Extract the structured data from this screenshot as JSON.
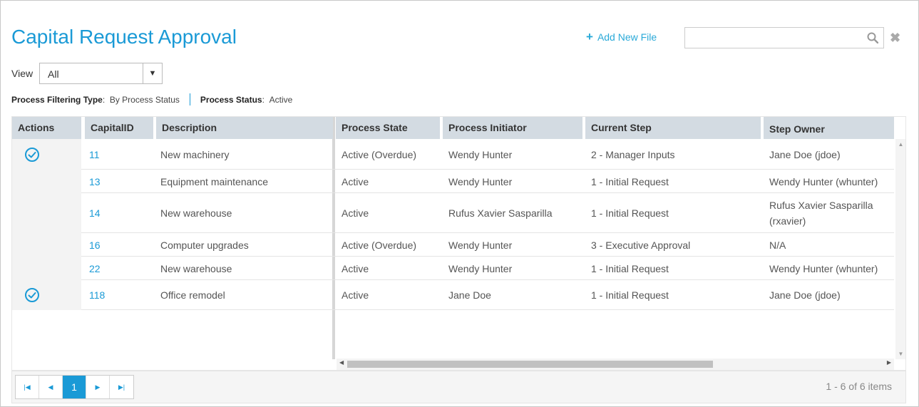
{
  "page": {
    "title": "Capital Request Approval",
    "add_file_label": "Add New File",
    "search_placeholder": "",
    "view_label": "View",
    "view_value": "All",
    "filter_type_label": "Process Filtering Type",
    "filter_type_value": "By Process Status",
    "process_status_label": "Process Status",
    "process_status_value": "Active"
  },
  "grid": {
    "columns": [
      "Actions",
      "CapitalID",
      "Description",
      "Process State",
      "Process Initiator",
      "Current Step",
      "Step Owner"
    ],
    "rows": [
      {
        "action": true,
        "id": "11",
        "description": "New machinery",
        "state": "Active (Overdue)",
        "initiator": "Wendy Hunter",
        "step": "2 - Manager Inputs",
        "owner": "Jane Doe (jdoe)"
      },
      {
        "action": false,
        "id": "13",
        "description": "Equipment maintenance",
        "state": "Active",
        "initiator": "Wendy Hunter",
        "step": "1 - Initial Request",
        "owner": "Wendy Hunter (whunter)"
      },
      {
        "action": false,
        "id": "14",
        "description": "New warehouse",
        "state": "Active",
        "initiator": "Rufus Xavier Sasparilla",
        "step": "1 - Initial Request",
        "owner": "Rufus Xavier Sasparilla",
        "owner2": "(rxavier)"
      },
      {
        "action": false,
        "id": "16",
        "description": "Computer upgrades",
        "state": "Active (Overdue)",
        "initiator": "Wendy Hunter",
        "step": "3 - Executive Approval",
        "owner": "N/A"
      },
      {
        "action": false,
        "id": "22",
        "description": "New warehouse",
        "state": "Active",
        "initiator": "Wendy Hunter",
        "step": "1 - Initial Request",
        "owner": "Wendy Hunter (whunter)"
      },
      {
        "action": true,
        "id": "118",
        "description": "Office remodel",
        "state": "Active",
        "initiator": "Jane Doe",
        "step": "1 - Initial Request",
        "owner": "Jane Doe (jdoe)"
      }
    ]
  },
  "pager": {
    "current_page": "1",
    "items_info": "1 - 6 of 6 items"
  },
  "colors": {
    "accent": "#1a9ad6",
    "header_bg": "#d3dbe2"
  },
  "icons": {
    "add": "plus-icon",
    "search": "search-icon",
    "clear": "close-icon",
    "dropdown": "caret-down-icon",
    "action": "check-circle-icon"
  }
}
